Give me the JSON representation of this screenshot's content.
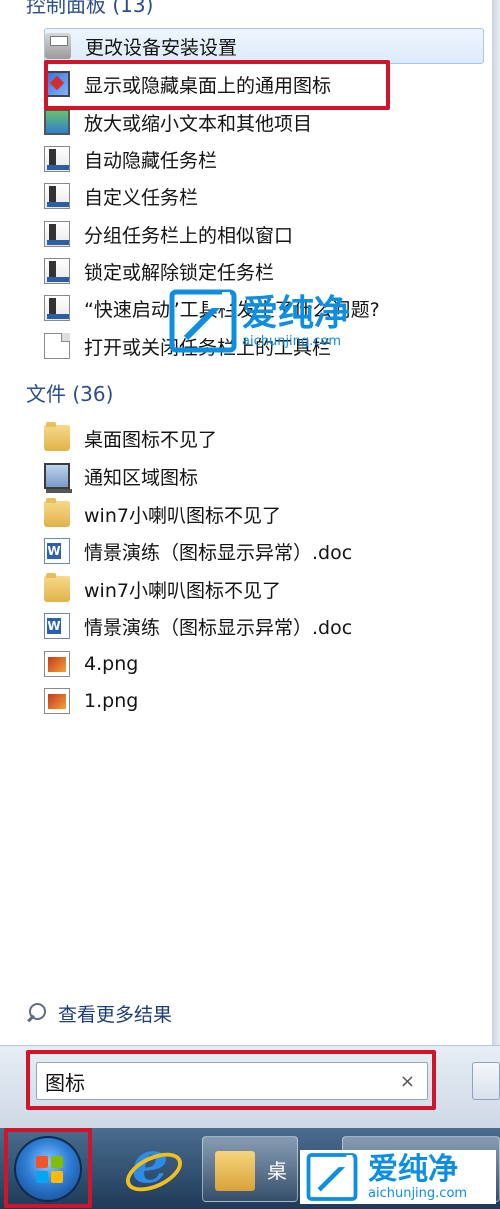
{
  "control_panel": {
    "header": "控制面板 (13)",
    "items": [
      {
        "label": "更改设备安装设置",
        "icon": "printer-icon"
      },
      {
        "label": "显示或隐藏桌面上的通用图标",
        "icon": "monitor-icon"
      },
      {
        "label": "放大或缩小文本和其他项目",
        "icon": "display-icon"
      },
      {
        "label": "自动隐藏任务栏",
        "icon": "taskbar-icon"
      },
      {
        "label": "自定义任务栏",
        "icon": "taskbar-icon"
      },
      {
        "label": "分组任务栏上的相似窗口",
        "icon": "taskbar-icon"
      },
      {
        "label": "锁定或解除锁定任务栏",
        "icon": "taskbar-icon"
      },
      {
        "label": "“快速启动”工具栏发生了什么问题?",
        "icon": "taskbar-icon"
      },
      {
        "label": "打开或关闭任务栏上的工具栏",
        "icon": "document-icon"
      }
    ]
  },
  "files": {
    "header": "文件 (36)",
    "items": [
      {
        "label": "桌面图标不见了",
        "icon": "folder-icon"
      },
      {
        "label": "通知区域图标",
        "icon": "notification-area-icon"
      },
      {
        "label": "win7小喇叭图标不见了",
        "icon": "folder-icon"
      },
      {
        "label": "情景演练（图标显示异常）.doc",
        "icon": "word-document-icon"
      },
      {
        "label": "win7小喇叭图标不见了",
        "icon": "folder-icon"
      },
      {
        "label": "情景演练（图标显示异常）.doc",
        "icon": "word-document-icon"
      },
      {
        "label": "4.png",
        "icon": "image-file-icon"
      },
      {
        "label": "1.png",
        "icon": "image-file-icon"
      }
    ]
  },
  "more_results": "查看更多结果",
  "search": {
    "value": "图标",
    "clear_symbol": "×"
  },
  "taskbar": {
    "folder_button_label": "桌"
  },
  "watermark": {
    "main": "爱纯净",
    "sub": "aichunjing.com"
  },
  "colors": {
    "highlight_box": "#d0152a",
    "header_text": "#2b4f8a",
    "watermark": "#0d8ee0"
  }
}
